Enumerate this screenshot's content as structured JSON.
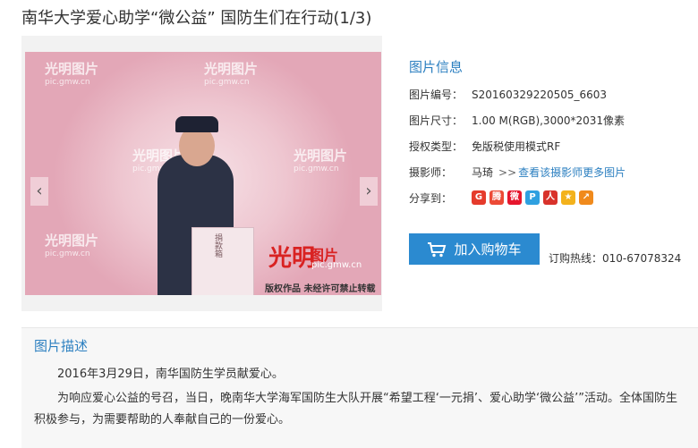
{
  "page_title": "南华大学爱心助学“微公益” 国防生们在行动(1/3)",
  "viewer": {
    "watermark_logo": "光明",
    "watermark_text": "图片",
    "watermark_url": "pic.gmw.cn",
    "brand_logo": "光明",
    "brand_text": "图片",
    "brand_url": "pic.gmw.cn",
    "copyright": "版权作品  未经许可禁止转载",
    "box_label": "捐款箱",
    "prev": "‹",
    "next": "›"
  },
  "info": {
    "heading": "图片信息",
    "rows": [
      {
        "label": "图片编号：",
        "value": "S20160329220505_6603"
      },
      {
        "label": "图片尺寸：",
        "value": "1.00 M(RGB),3000*2031像素"
      },
      {
        "label": "授权类型：",
        "value": "免版税使用模式RF"
      },
      {
        "label": "摄影师：",
        "value": "马琦",
        "link": "查看该摄影师更多图片",
        "arrows": ">>"
      },
      {
        "label": "分享到：",
        "value": ""
      }
    ],
    "share_icons": [
      {
        "name": "google-icon",
        "glyph": "G",
        "color": "#e53b2c"
      },
      {
        "name": "tencent-weibo-icon",
        "glyph": "腾",
        "color": "#ec4a36"
      },
      {
        "name": "sina-weibo-icon",
        "glyph": "微",
        "color": "#e6162d"
      },
      {
        "name": "qzone-icon",
        "glyph": "P",
        "color": "#2fa0e0"
      },
      {
        "name": "renren-icon",
        "glyph": "人",
        "color": "#d8322b"
      },
      {
        "name": "qq-zone-star-icon",
        "glyph": "★",
        "color": "#f3b21c"
      },
      {
        "name": "share-more-icon",
        "glyph": "↗",
        "color": "#f08a1c"
      }
    ]
  },
  "cart": {
    "label": "加入购物车"
  },
  "hotline": "订购热线：010-67078324",
  "description": {
    "heading": "图片描述",
    "p1": "2016年3月29日，南华国防生学员献爱心。",
    "p2": "为响应爱心公益的号召，当日，晚南华大学海军国防生大队开展“希望工程‘一元捐’、爱心助学‘微公益’”活动。全体国防生积极参与，为需要帮助的人奉献自己的一份爱心。"
  }
}
